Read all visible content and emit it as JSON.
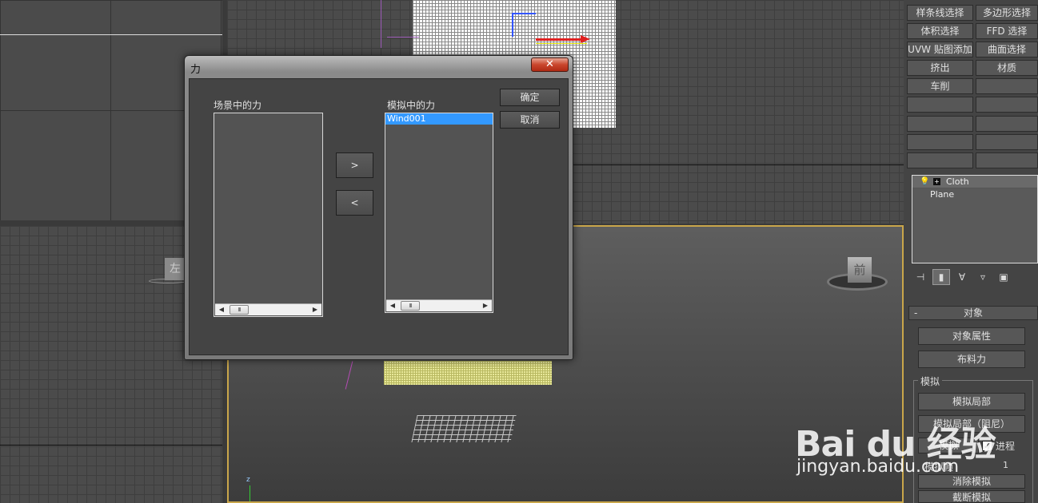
{
  "dialog": {
    "title": "力",
    "close_glyph": "✕",
    "scene_forces_label": "场景中的力",
    "sim_forces_label": "模拟中的力",
    "scene_forces": [],
    "sim_forces": [
      {
        "name": "Wind001",
        "selected": true
      }
    ],
    "add_label": ">",
    "remove_label": "<",
    "ok_label": "确定",
    "cancel_label": "取消",
    "scroll_left": "◀",
    "scroll_right": "▶",
    "scroll_thumb": "III"
  },
  "command_panel": {
    "buttons": [
      {
        "label": "样条线选择"
      },
      {
        "label": "多边形选择"
      },
      {
        "label": "体积选择"
      },
      {
        "label": "FFD 选择"
      },
      {
        "label": "UVW 贴图添加"
      },
      {
        "label": "曲面选择"
      },
      {
        "label": "挤出"
      },
      {
        "label": "材质"
      },
      {
        "label": "车削"
      },
      {
        "label": ""
      },
      {
        "label": ""
      },
      {
        "label": ""
      },
      {
        "label": ""
      },
      {
        "label": ""
      },
      {
        "label": ""
      },
      {
        "label": ""
      },
      {
        "label": ""
      },
      {
        "label": ""
      }
    ],
    "stack": {
      "modifier": "Cloth",
      "base": "Plane"
    },
    "rollout": {
      "collapse": "-",
      "title": "对象",
      "object_props_label": "对象属性",
      "cloth_forces_label": "布料力",
      "sim_group_label": "模拟",
      "sim_local_label": "模拟局部",
      "sim_local_damped_label": "模拟局部（阻尼）",
      "simulate_label": "模拟",
      "progress_label": "进程",
      "progress_checked": true,
      "sim_frames_label": "模拟帧",
      "sim_frames_value": "1",
      "erase_sim_label": "消除模拟",
      "truncate_sim_label": "截断模拟"
    }
  },
  "viewport": {
    "front_cube_label": "前",
    "left_cube_label": "左",
    "axis_z": "z"
  },
  "watermark": {
    "brand": "Bai du 经验",
    "url": "jingyan.baidu.com"
  },
  "colors": {
    "selection": "#3399ff",
    "active_border": "#c9a64a",
    "close_red": "#c9452c"
  }
}
